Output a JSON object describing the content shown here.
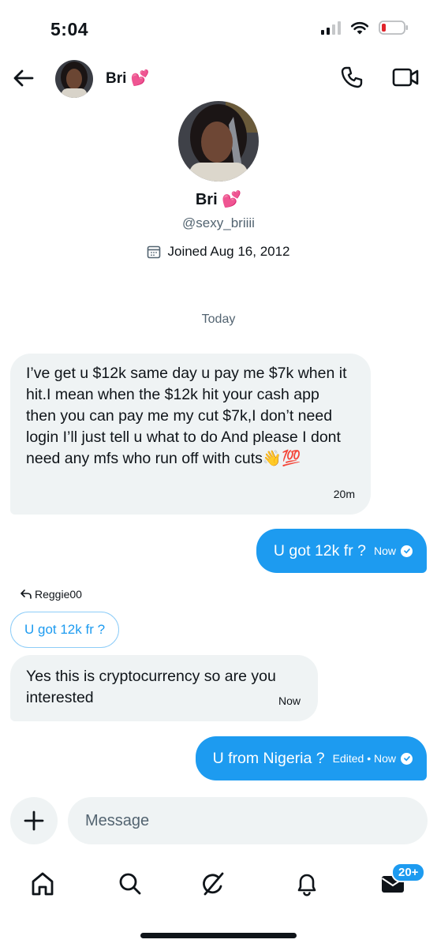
{
  "status_bar": {
    "time": "5:04"
  },
  "header": {
    "contact_name": "Bri",
    "contact_emoji": "💕"
  },
  "profile": {
    "name": "Bri",
    "emoji": "💕",
    "handle": "@sexy_briiii",
    "joined": "Joined Aug 16, 2012"
  },
  "conversation": {
    "date_separator": "Today",
    "messages": [
      {
        "direction": "incoming",
        "text": "I’ve get u $12k same day u pay me $7k when it hit.I mean when the $12k hit your cash app then you can pay me my cut $7k,I don’t need login I’ll just tell u what to do And please I dont need any mfs who run off with cuts",
        "emoji": "👋💯",
        "time": "20m"
      },
      {
        "direction": "outgoing",
        "text": "U got 12k fr ?",
        "time": "Now"
      },
      {
        "direction": "incoming",
        "reply_to_user": "Reggie00",
        "quoted_text": "U got 12k fr ?",
        "text": "Yes this is cryptocurrency so are you interested",
        "time": "Now"
      },
      {
        "direction": "outgoing",
        "text": "U from Nigeria ?",
        "time": "Edited • Now"
      }
    ]
  },
  "composer": {
    "placeholder": "Message"
  },
  "tabbar": {
    "items": [
      "home-icon",
      "search-icon",
      "grok-icon",
      "notifications-icon",
      "messages-icon"
    ],
    "messages_badge": "20+"
  },
  "colors": {
    "accent": "#1d9bf0",
    "bubble_incoming": "#eff3f4",
    "text_secondary": "#536471"
  }
}
